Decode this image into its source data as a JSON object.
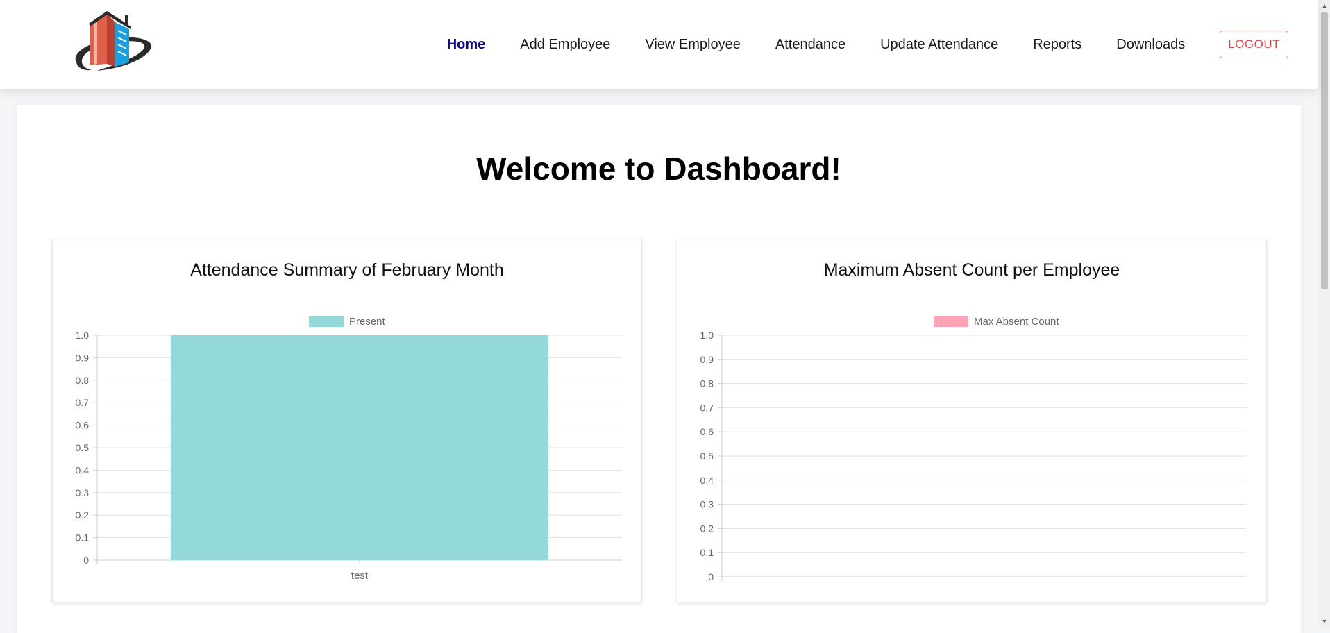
{
  "nav": {
    "logo": "building-logo",
    "links": [
      "Home",
      "Add Employee",
      "View Employee",
      "Attendance",
      "Update Attendance",
      "Reports",
      "Downloads"
    ],
    "active": "Home",
    "logout_label": "LOGOUT"
  },
  "main": {
    "title": "Welcome to Dashboard!"
  },
  "charts": {
    "left_title": "Attendance Summary of February Month",
    "right_title": "Maximum Absent Count per Employee"
  },
  "colors": {
    "present": "#94d9da",
    "absent": "#ffa4b6",
    "active_nav": "#0a0a8a",
    "logout": "#d64a4a"
  },
  "chart_data": [
    {
      "type": "bar",
      "categories": [
        "test"
      ],
      "series": [
        {
          "name": "Present",
          "values": [
            1
          ]
        }
      ],
      "ylim": [
        0,
        1
      ],
      "yticks": [
        0,
        0.1,
        0.2,
        0.3,
        0.4,
        0.5,
        0.6,
        0.7,
        0.8,
        0.9,
        1.0
      ],
      "ytick_labels": [
        "0",
        "0.1",
        "0.2",
        "0.3",
        "0.4",
        "0.5",
        "0.6",
        "0.7",
        "0.8",
        "0.9",
        "1.0"
      ],
      "legend": "top",
      "grid": true
    },
    {
      "type": "bar",
      "categories": [],
      "series": [
        {
          "name": "Max Absent Count",
          "values": []
        }
      ],
      "ylim": [
        0,
        1
      ],
      "yticks": [
        0,
        0.1,
        0.2,
        0.3,
        0.4,
        0.5,
        0.6,
        0.7,
        0.8,
        0.9,
        1.0
      ],
      "ytick_labels": [
        "0",
        "0.1",
        "0.2",
        "0.3",
        "0.4",
        "0.5",
        "0.6",
        "0.7",
        "0.8",
        "0.9",
        "1.0"
      ],
      "legend": "top",
      "grid": true
    }
  ]
}
